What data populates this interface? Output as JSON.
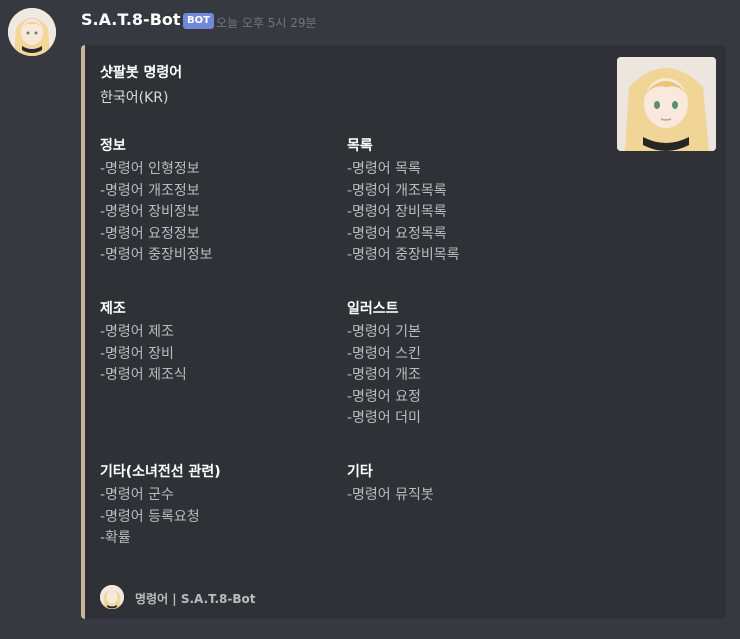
{
  "message": {
    "username": "S.A.T.8-Bot",
    "bot_tag": "BOT",
    "timestamp": "오늘 오후 5시 29분"
  },
  "embed": {
    "accent_color": "#c8b795",
    "title": "샷팔봇 명령어",
    "description": "한국어(KR)",
    "fields": [
      {
        "name": "정보",
        "lines": [
          "-명령어 인형정보",
          "-명령어 개조정보",
          "-명령어 장비정보",
          "-명령어 요정정보",
          "-명령어 중장비정보"
        ]
      },
      {
        "name": "목록",
        "lines": [
          "-명령어 목록",
          "-명령어 개조목록",
          "-명령어 장비목록",
          "-명령어 요정목록",
          "-명령어 중장비목록"
        ]
      },
      {
        "name": "제조",
        "lines": [
          "-명령어 제조",
          "-명령어 장비",
          "-명령어 제조식"
        ]
      },
      {
        "name": "일러스트",
        "lines": [
          "-명령어 기본",
          "-명령어 스킨",
          "-명령어 개조",
          "-명령어 요정",
          "-명령어 더미"
        ]
      },
      {
        "name": "기타(소녀전선 관련)",
        "lines": [
          "-명령어 군수",
          "-명령어 등록요청",
          "-확률"
        ]
      },
      {
        "name": "기타",
        "lines": [
          "-명령어 뮤직봇"
        ]
      }
    ],
    "footer": {
      "text": "명령어 | S.A.T.8-Bot"
    }
  }
}
